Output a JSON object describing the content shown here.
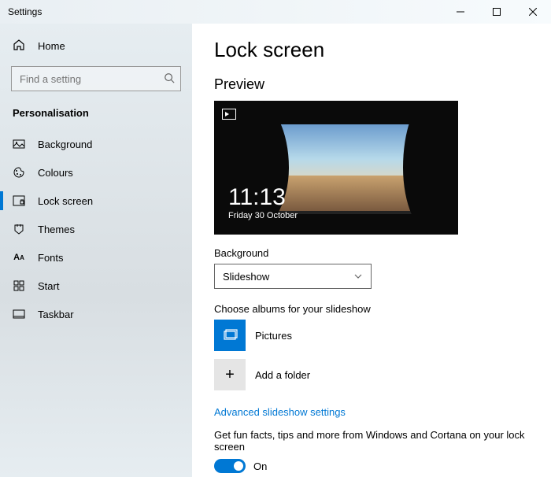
{
  "window": {
    "title": "Settings"
  },
  "sidebar": {
    "home": "Home",
    "search_placeholder": "Find a setting",
    "section": "Personalisation",
    "items": [
      {
        "label": "Background"
      },
      {
        "label": "Colours"
      },
      {
        "label": "Lock screen"
      },
      {
        "label": "Themes"
      },
      {
        "label": "Fonts"
      },
      {
        "label": "Start"
      },
      {
        "label": "Taskbar"
      }
    ]
  },
  "content": {
    "title": "Lock screen",
    "preview_heading": "Preview",
    "clock": {
      "time": "11:13",
      "date": "Friday 30 October"
    },
    "background_label": "Background",
    "background_value": "Slideshow",
    "choose_albums": "Choose albums for your slideshow",
    "albums": {
      "pictures": "Pictures",
      "add": "Add a folder"
    },
    "advanced_link": "Advanced slideshow settings",
    "tips_label": "Get fun facts, tips and more from Windows and Cortana on your lock screen",
    "toggle_state": "On"
  }
}
